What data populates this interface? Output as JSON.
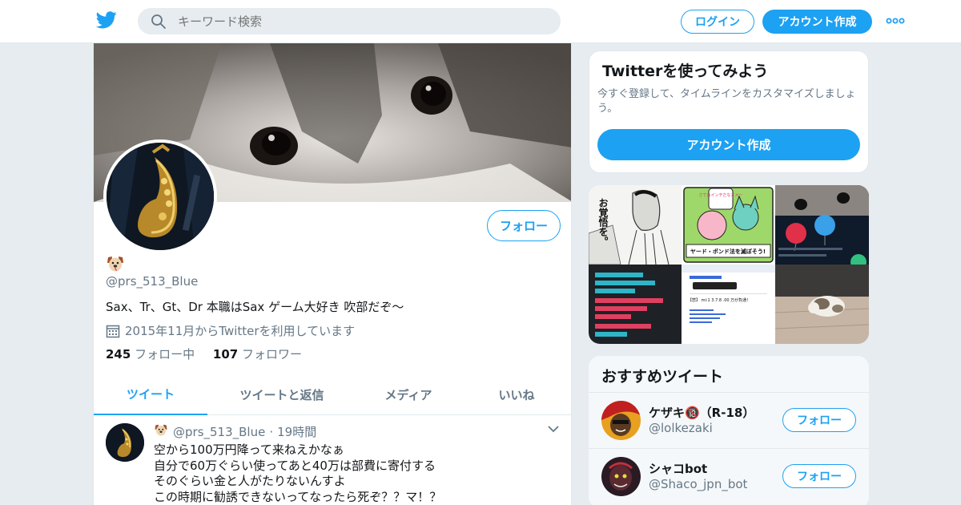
{
  "header": {
    "logo_icon": "twitter-bird-icon",
    "search_placeholder": "キーワード検索",
    "login_label": "ログイン",
    "signup_label": "アカウント作成",
    "more_icon": "more-dots-icon",
    "accent_color": "#1da1f2"
  },
  "profile": {
    "name_emoji": "🐶",
    "handle": "@prs_513_Blue",
    "bio": "Sax、Tr、Gt、Dr 本職はSax ゲーム大好き 吹部だぞ〜",
    "joined": "2015年11月からTwitterを利用しています",
    "following_count": "245",
    "following_label": "フォロー中",
    "followers_count": "107",
    "followers_label": "フォロワー",
    "follow_label": "フォロー"
  },
  "tabs": [
    {
      "label": "ツイート",
      "active": true
    },
    {
      "label": "ツイートと返信",
      "active": false
    },
    {
      "label": "メディア",
      "active": false
    },
    {
      "label": "いいね",
      "active": false
    }
  ],
  "tweet": {
    "emoji": "🐶",
    "handle": "@prs_513_Blue",
    "separator": "·",
    "time": "19時間",
    "text": "空から100万円降って来ねえかなぁ\n自分で60万ぐらい使ってあと40万は部費に寄付する\nそのぐらい金と人がたりないんすよ\nこの時期に勧誘できないってなったら死ぞ？？マ！？"
  },
  "signup_card": {
    "title": "Twitterを使ってみよう",
    "description": "今すぐ登録して、タイムラインをカスタマイズしましょう。",
    "button_label": "アカウント作成"
  },
  "media_texts": {
    "manga_text": "お覚悟を。",
    "poster_text": "ヤード・ポンド法を滅ぼそう!",
    "bubble_text": "さてはインチだなオメー",
    "list_text": "【悲】 mi:1 3.7.8 .00 万が負通！"
  },
  "recommended": {
    "title": "おすすめツイート",
    "follow_label": "フォロー",
    "users": [
      {
        "name": "ケザキ🔞（R-18）",
        "handle": "@lolkezaki"
      },
      {
        "name": "シャコbot",
        "handle": "@Shaco_jpn_bot"
      }
    ]
  }
}
